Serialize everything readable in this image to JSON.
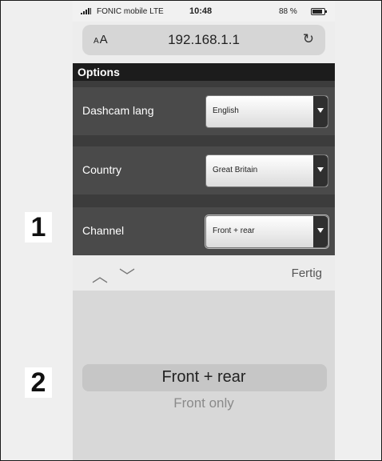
{
  "status_bar": {
    "carrier": "FONIC mobile  LTE",
    "time": "10:48",
    "battery": "88 %",
    "icons": [
      "signal-icon",
      "battery-icon"
    ]
  },
  "browser": {
    "text_size": "AA",
    "url": "192.168.1.1",
    "reload_icon": "↻"
  },
  "options": {
    "title": "Options",
    "rows": [
      {
        "label": "Dashcam lang",
        "value": "English"
      },
      {
        "label": "Country",
        "value": "Great Britain"
      },
      {
        "label": "Channel",
        "value": "Front + rear"
      }
    ]
  },
  "accessory_bar": {
    "up_icon": "︿",
    "down_icon": "﹀",
    "done_label": "Fertig"
  },
  "picker": {
    "selected": "Front + rear",
    "next_option": "Front only"
  },
  "callouts": [
    "1",
    "2"
  ],
  "colors": {
    "options_header": "#1c1c1c",
    "options_row": "#4a4a4a",
    "picker_bg": "#d8d8d8"
  }
}
